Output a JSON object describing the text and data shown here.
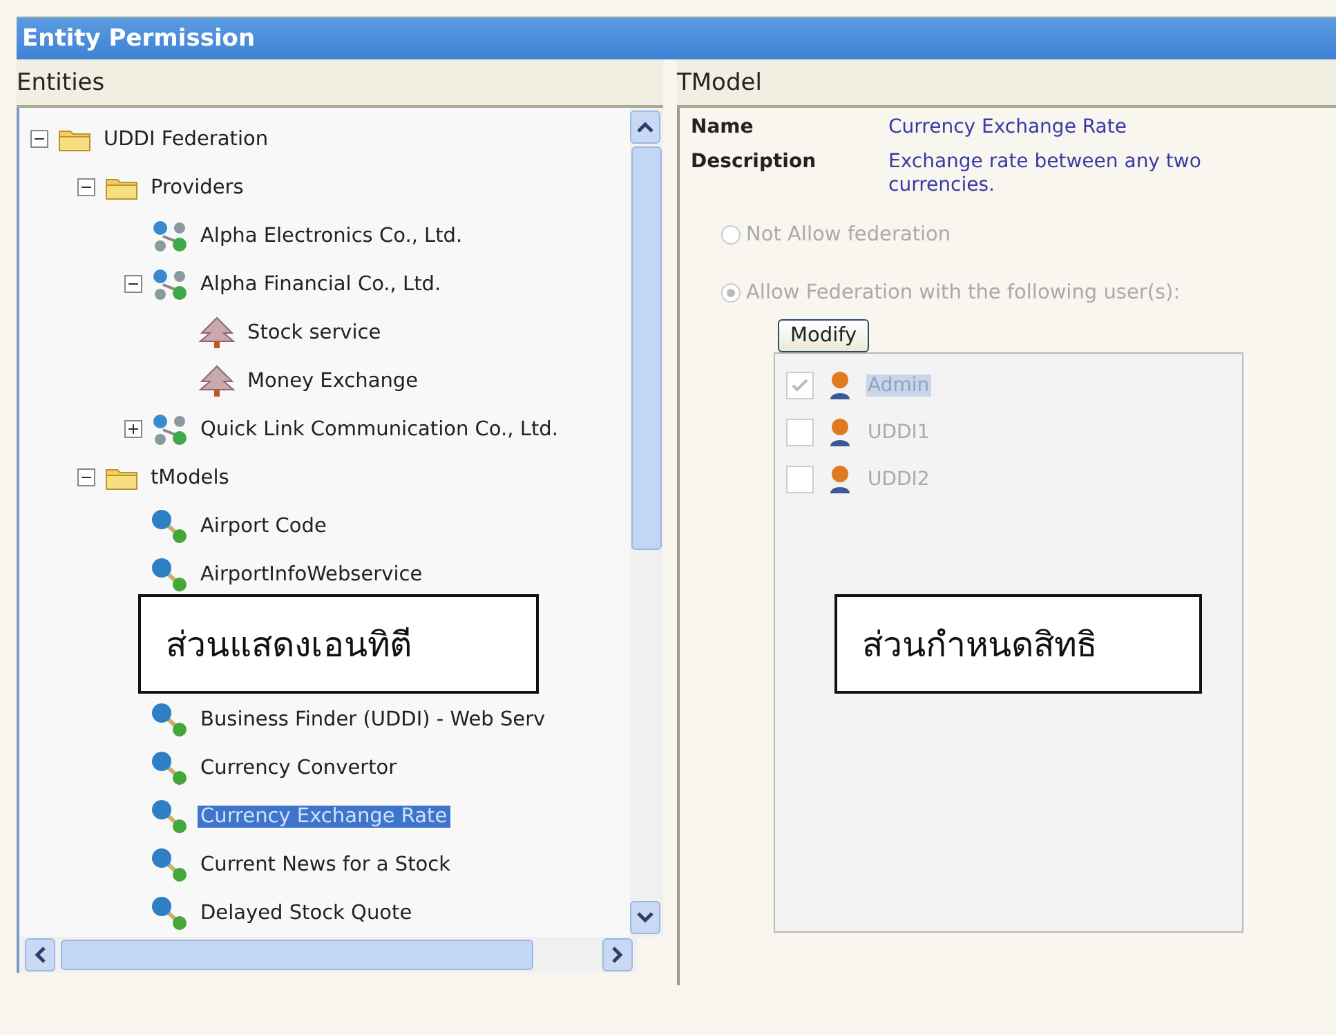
{
  "window": {
    "title": "Entity Permission"
  },
  "entities": {
    "header": "Entities",
    "tree": [
      {
        "label": "UDDI Federation",
        "kind": "folder",
        "expanded": true,
        "selected": false,
        "children": [
          {
            "label": "Providers",
            "kind": "folder",
            "expanded": true,
            "selected": false,
            "children": [
              {
                "label": "Alpha Electronics Co., Ltd.",
                "kind": "provider",
                "selected": false
              },
              {
                "label": "Alpha Financial Co., Ltd.",
                "kind": "provider",
                "expanded": true,
                "selected": false,
                "children": [
                  {
                    "label": "Stock service",
                    "kind": "service",
                    "selected": false
                  },
                  {
                    "label": "Money Exchange",
                    "kind": "service",
                    "selected": false
                  }
                ]
              },
              {
                "label": "Quick Link Communication Co., Ltd.",
                "kind": "provider",
                "expanded": false,
                "selected": false
              }
            ]
          },
          {
            "label": "tModels",
            "kind": "folder",
            "expanded": true,
            "selected": false,
            "children": [
              {
                "label": "Airport Code",
                "kind": "tmodel",
                "selected": false
              },
              {
                "label": "AirportInfoWebservice",
                "kind": "tmodel",
                "selected": false
              },
              {
                "kind": "covered"
              },
              {
                "kind": "covered"
              },
              {
                "label": "Business Finder (UDDI) - Web Serv",
                "kind": "tmodel",
                "selected": false
              },
              {
                "label": "Currency Convertor",
                "kind": "tmodel",
                "selected": false
              },
              {
                "label": "Currency Exchange Rate",
                "kind": "tmodel",
                "selected": true
              },
              {
                "label": "Current News for a Stock",
                "kind": "tmodel",
                "selected": false
              },
              {
                "label": "Delayed Stock Quote",
                "kind": "tmodel",
                "selected": false
              }
            ]
          }
        ]
      }
    ]
  },
  "detail": {
    "header": "TModel",
    "fields": [
      {
        "label": "Name",
        "value": "Currency Exchange Rate"
      },
      {
        "label": "Description",
        "value": "Exchange rate between any two currencies."
      }
    ],
    "federation": {
      "disabled": true,
      "options": [
        {
          "label": "Not Allow federation",
          "selected": false
        },
        {
          "label": "Allow Federation with the following user(s):",
          "selected": true
        }
      ],
      "button": "Modify",
      "users": [
        {
          "name": "Admin",
          "checked": true,
          "selected": true
        },
        {
          "name": "UDDI1",
          "checked": false,
          "selected": false
        },
        {
          "name": "UDDI2",
          "checked": false,
          "selected": false
        }
      ]
    }
  },
  "callouts": [
    "ส่วนแสดงเอนทิตี",
    "ส่วนกำหนดสิทธิ"
  ]
}
